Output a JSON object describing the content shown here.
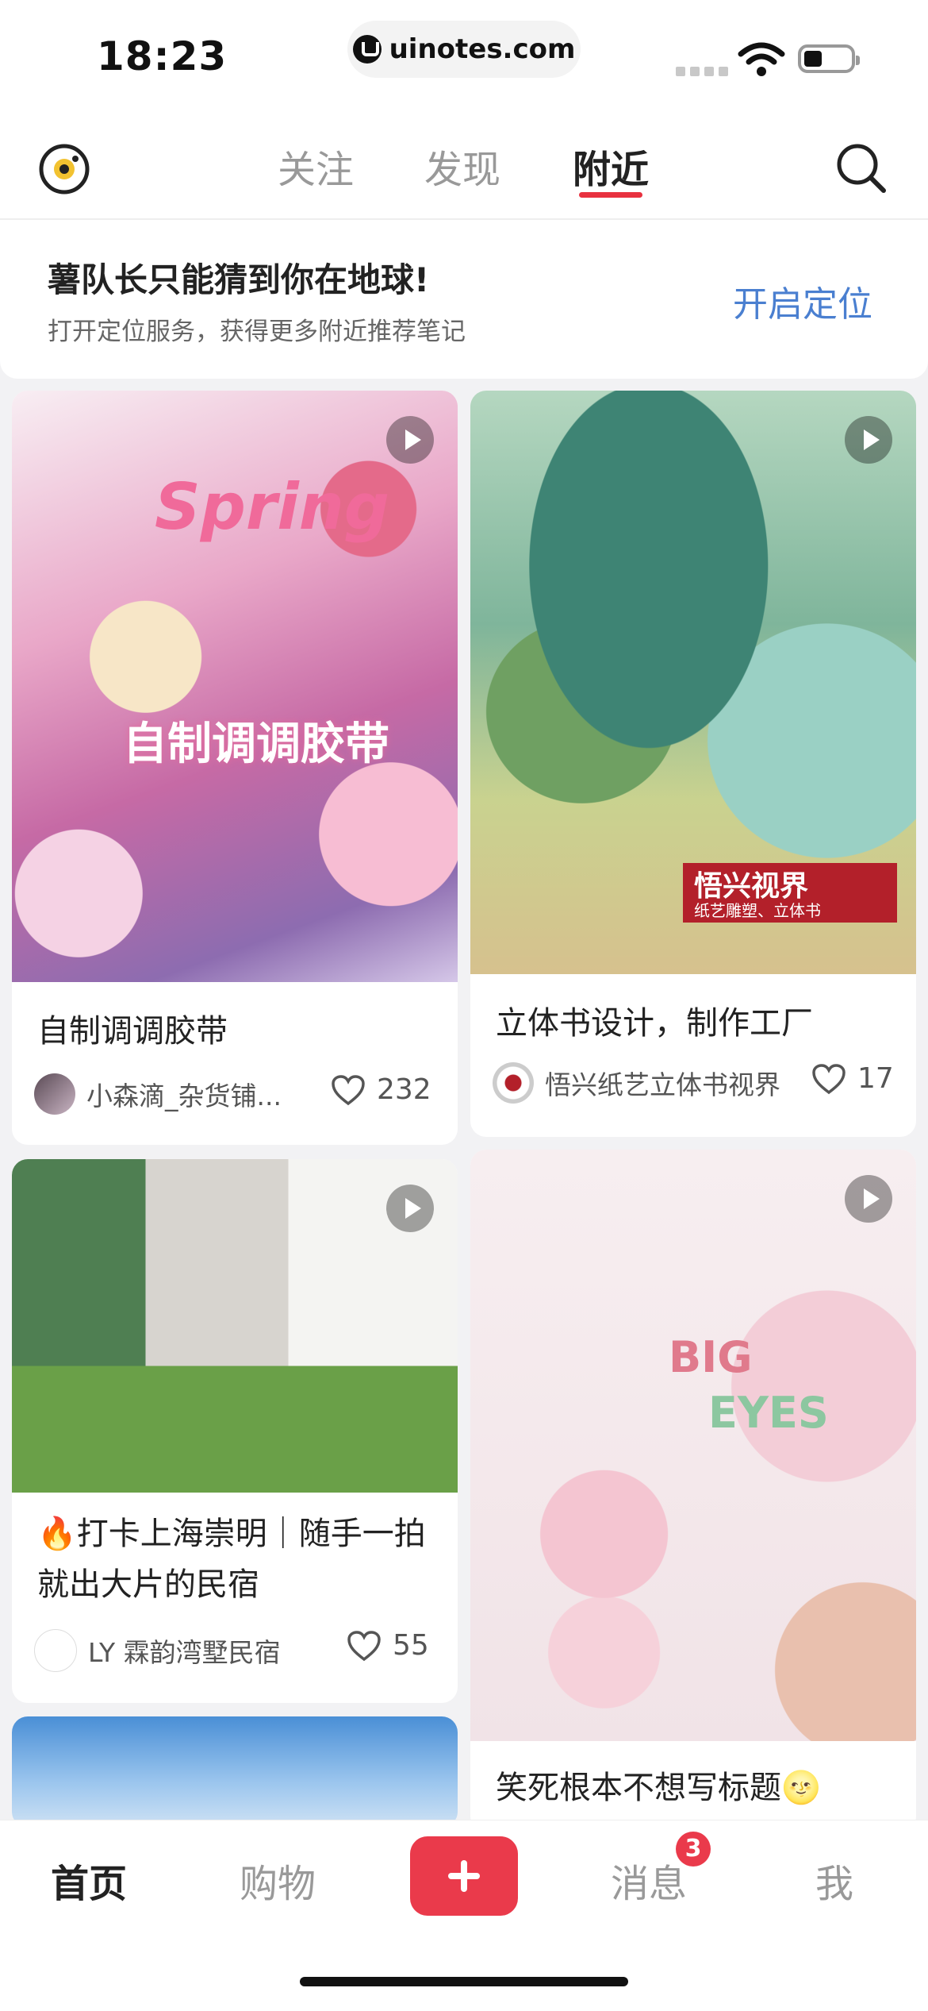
{
  "status_bar": {
    "time": "18:23",
    "url": "uinotes.com"
  },
  "nav": {
    "tabs": [
      "关注",
      "发现",
      "附近"
    ],
    "active_tab": "附近"
  },
  "banner": {
    "title": "薯队长只能猜到你在地球!",
    "subtitle": "打开定位服务，获得更多附近推荐笔记",
    "action": "开启定位"
  },
  "feed": [
    {
      "title": "自制调调胶带",
      "author": "小森滴_杂货铺...",
      "likes": "232",
      "is_video": true,
      "image_text": [
        "Spring",
        "自制调调胶带"
      ]
    },
    {
      "title": "立体书设计，制作工厂",
      "author": "悟兴纸艺立体书视界",
      "likes": "17",
      "is_video": true,
      "image_text": [
        "悟兴视界",
        "纸艺雕塑、立体书"
      ]
    },
    {
      "title": "🔥打卡上海崇明｜随手一拍就出大片的民宿",
      "author": "LY 霖韵湾墅民宿",
      "likes": "55",
      "is_video": true
    },
    {
      "title": "笑死根本不想写标题🌝",
      "is_video": true,
      "image_text": [
        "BIG",
        "EYES"
      ]
    }
  ],
  "bottom_tabs": {
    "home": "首页",
    "shop": "购物",
    "messages": "消息",
    "me": "我",
    "messages_badge": "3"
  },
  "colors": {
    "accent": "#ea3a4b",
    "link": "#4a7fd0"
  }
}
